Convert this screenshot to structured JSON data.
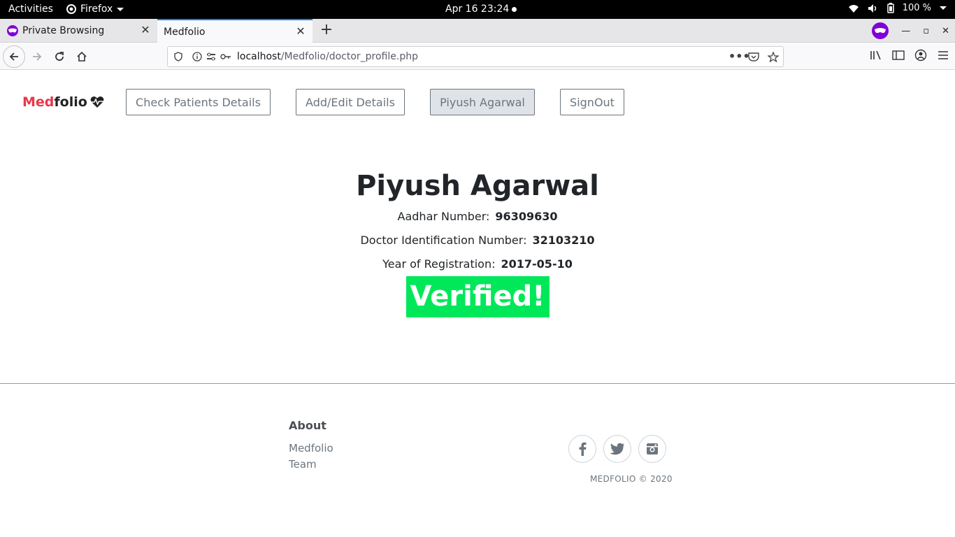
{
  "system": {
    "activities": "Activities",
    "app_name": "Firefox",
    "clock": "Apr 16  23:24",
    "battery": "100 %"
  },
  "browser": {
    "tabs": [
      {
        "label": "Private Browsing",
        "active": false
      },
      {
        "label": "Medfolio",
        "active": true
      }
    ],
    "url_host": "localhost",
    "url_path": "/Medfolio/doctor_profile.php"
  },
  "site": {
    "brand_accent": "Med",
    "brand_rest": "folio",
    "nav": {
      "check_patients": "Check Patients Details",
      "add_edit": "Add/Edit Details",
      "user": "Piyush Agarwal",
      "signout": "SignOut"
    },
    "profile": {
      "name": "Piyush Agarwal",
      "aadhar_label": "Aadhar Number:",
      "aadhar_value": "96309630",
      "doctor_id_label": "Doctor Identification Number:",
      "doctor_id_value": "32103210",
      "registration_label": "Year of Registration:",
      "registration_value": "2017-05-10",
      "status": "Verified!"
    },
    "footer": {
      "about_heading": "About",
      "links": [
        "Medfolio",
        "Team"
      ],
      "copyright": "MEDFOLIO © 2020"
    }
  },
  "colors": {
    "brand_accent": "#e8374a",
    "verified_bg": "#00e85a",
    "private_purple": "#8000d7"
  }
}
